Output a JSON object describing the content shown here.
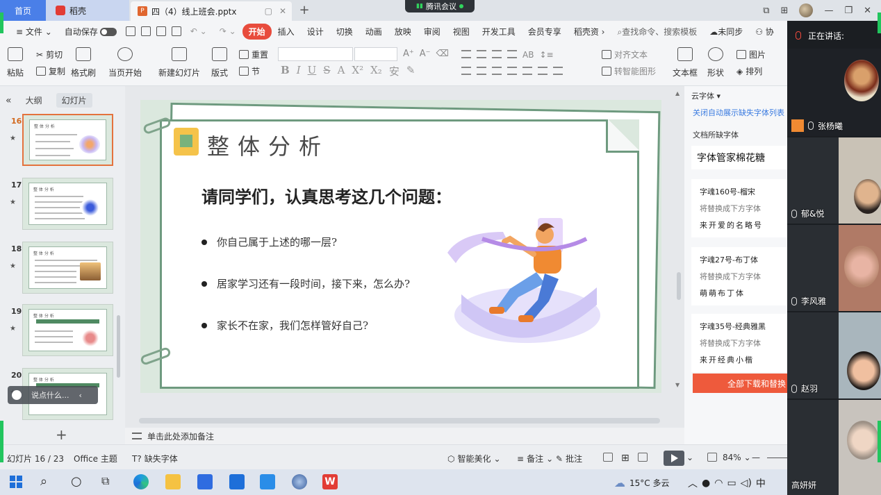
{
  "titlebar": {
    "tab_home": "首页",
    "tab_daoke": "稻壳",
    "tab_doc": "四（4）线上班会.pptx",
    "meeting": "腾讯会议"
  },
  "menu": {
    "file": "文件",
    "autosave": "自动保存",
    "tabs": [
      "开始",
      "插入",
      "设计",
      "切换",
      "动画",
      "放映",
      "审阅",
      "视图",
      "开发工具",
      "会员专享",
      "稻壳资"
    ],
    "search": "查找命令、搜索模板",
    "sync": "未同步",
    "collab": "协"
  },
  "ribbon": {
    "paste": "粘贴",
    "cut": "剪切",
    "copy": "复制",
    "format_painter": "格式刷",
    "from_current": "当页开始",
    "new_slide": "新建幻灯片",
    "layout": "版式",
    "reset": "重置",
    "section": "节",
    "align_text": "对齐文本",
    "smart_graphic": "转智能图形",
    "textbox": "文本框",
    "shape": "形状",
    "picture": "图片",
    "arrange": "排列"
  },
  "leftpanel": {
    "tab_outline": "大纲",
    "tab_slides": "幻灯片",
    "slides": [
      {
        "num": "16",
        "title": "整 体 分 析"
      },
      {
        "num": "17",
        "title": "整 体 分 析"
      },
      {
        "num": "18",
        "title": "整 体 分 析"
      },
      {
        "num": "19",
        "title": "整 体 分 析"
      },
      {
        "num": "20",
        "title": "整 体 分 析"
      }
    ],
    "chat_placeholder": "说点什么..."
  },
  "slide": {
    "title": "整体分析",
    "subtitle": "请同学们，认真思考这几个问题：",
    "bullets": [
      "你自己属于上述的哪一层?",
      "居家学习还有一段时间，接下来，怎么办?",
      "家长不在家，我们怎样管好自己?"
    ]
  },
  "notes": {
    "placeholder": "单击此处添加备注"
  },
  "fontpanel": {
    "header": "云字体",
    "link": "关闭自动展示缺失字体列表",
    "missing_label": "文档所缺字体",
    "missing_font": "字体管家棉花糖",
    "cards": [
      {
        "name": "字魂160号-榴宋",
        "replace": "将替换成下方字体",
        "sample": "来开爱的名略号"
      },
      {
        "name": "字魂27号-布丁体",
        "replace": "将替换成下方字体",
        "sample": "萌萌布丁体"
      },
      {
        "name": "字魂35号-经典雅黑",
        "replace": "将替换成下方字体",
        "sample": "来开经典小楷"
      }
    ],
    "download_all": "全部下载和替换"
  },
  "statusbar": {
    "slide_count": "幻灯片 16 / 23",
    "theme": "Office 主题",
    "missing_font": "缺失字体",
    "beautify": "智能美化",
    "notes": "备注",
    "comments": "批注",
    "zoom": "84%"
  },
  "videopanel": {
    "speaking": "正在讲话:",
    "participants": [
      "张杨曦",
      "郁&悦",
      "李风雅",
      "赵羽",
      "高妍妍"
    ]
  },
  "taskbar": {
    "weather": "15°C 多云"
  },
  "colors": {
    "accent_red": "#e84c3d",
    "home_blue": "#4a7fe8",
    "slide_green": "#6e9a7f",
    "download_orange": "#ee5a3c"
  }
}
